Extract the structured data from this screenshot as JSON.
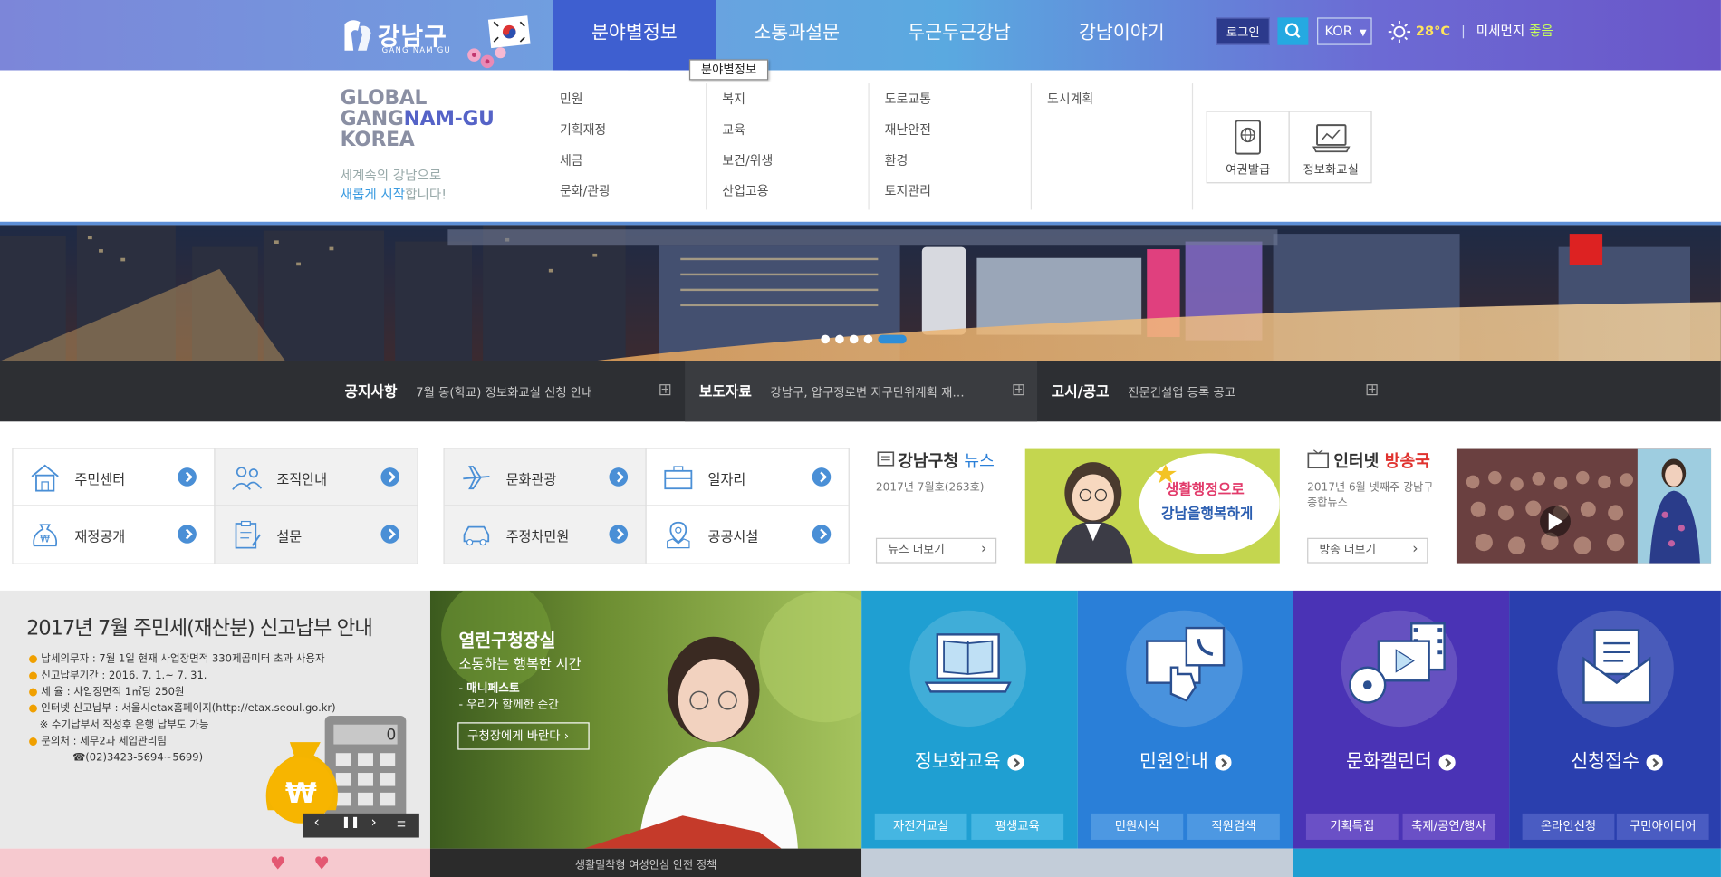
{
  "header": {
    "logo_kor": "강남구",
    "logo_eng": "GANG NAM GU",
    "nav": [
      "분야별정보",
      "소통과설문",
      "두근두근강남",
      "강남이야기"
    ],
    "tooltip": "분야별정보",
    "login": "로그인",
    "lang": "KOR",
    "temp": "28°C",
    "dust_label": "미세먼지",
    "dust_value": "좋음"
  },
  "mega": {
    "global_lines": [
      "GLOBAL",
      "GANGNAM-GU",
      "KOREA"
    ],
    "slogan1": "세계속의 강남으로",
    "slogan2_hl": "새롭게 시작",
    "slogan2_rest": "합니다!",
    "col1": [
      "민원",
      "기획재정",
      "세금",
      "문화/관광"
    ],
    "col2": [
      "복지",
      "교육",
      "보건/위생",
      "산업고용"
    ],
    "col3": [
      "도로교통",
      "재난안전",
      "환경",
      "토지관리"
    ],
    "col4": [
      "도시계획"
    ],
    "quick": [
      "여권발급",
      "정보화교실"
    ]
  },
  "notices": [
    {
      "title": "공지사항",
      "text": "7월 동(학교) 정보화교실 신청 안내"
    },
    {
      "title": "보도자료",
      "text": "강남구, 압구정로변 지구단위계획 재…"
    },
    {
      "title": "고시/공고",
      "text": "전문건설업 등록 공고"
    }
  ],
  "quick_left": [
    "주민센터",
    "조직안내",
    "재정공개",
    "설문"
  ],
  "quick_right": [
    "문화관광",
    "일자리",
    "주정차민원",
    "공공시설"
  ],
  "news": {
    "title": "강남구청",
    "title_hl": "뉴스",
    "date": "2017년 7월호(263호)",
    "more": "뉴스 더보기",
    "img_line1": "생활행정으로",
    "img_line2": "강남을행복하게"
  },
  "broadcast": {
    "title": "인터넷",
    "title_hl": "방송국",
    "desc1": "2017년 6월 넷째주 강남구",
    "desc2": "종합뉴스",
    "more": "방송 더보기"
  },
  "promo1": {
    "title": "2017년 7월 주민세(재산분) 신고납부 안내",
    "lines": [
      "납세의무자 : 7월 1일 현재 사업장면적 330제곱미터 초과 사용자",
      "신고납부기간 : 2016. 7. 1.~ 7. 31.",
      "세 율 : 사업장면적 1㎡당 250원",
      "인터넷 신고납부 : 서울시etax홈페이지(http://etax.seoul.go.kr)",
      "※ 수기납부서 작성후 은행 납부도 가능",
      "문의처 : 세무2과 세입관리팀",
      "☎(02)3423-5694~5699)"
    ],
    "calc_display": "0",
    "coin_symbol": "₩"
  },
  "promo2": {
    "title": "열린구청장실",
    "sub": "소통하는 행복한 시간",
    "b1": "매니페스토",
    "b2": "우리가 함께한 순간",
    "btn": "구청장에게 바란다",
    "bottom": "생활밀착형 여성안심 안전 정책"
  },
  "tiles": [
    {
      "title": "정보화교육",
      "subs": [
        "자전거교실",
        "평생교육"
      ],
      "color": "#1f9fd2"
    },
    {
      "title": "민원안내",
      "subs": [
        "민원서식",
        "직원검색"
      ],
      "color": "#2a7fd8"
    },
    {
      "title": "문화캘린더",
      "subs": [
        "기획특집",
        "축제/공연/행사"
      ],
      "color": "#4a33b5"
    },
    {
      "title": "신청접수",
      "subs": [
        "온라인신청",
        "구민아이디어"
      ],
      "color": "#2a3fae"
    }
  ]
}
